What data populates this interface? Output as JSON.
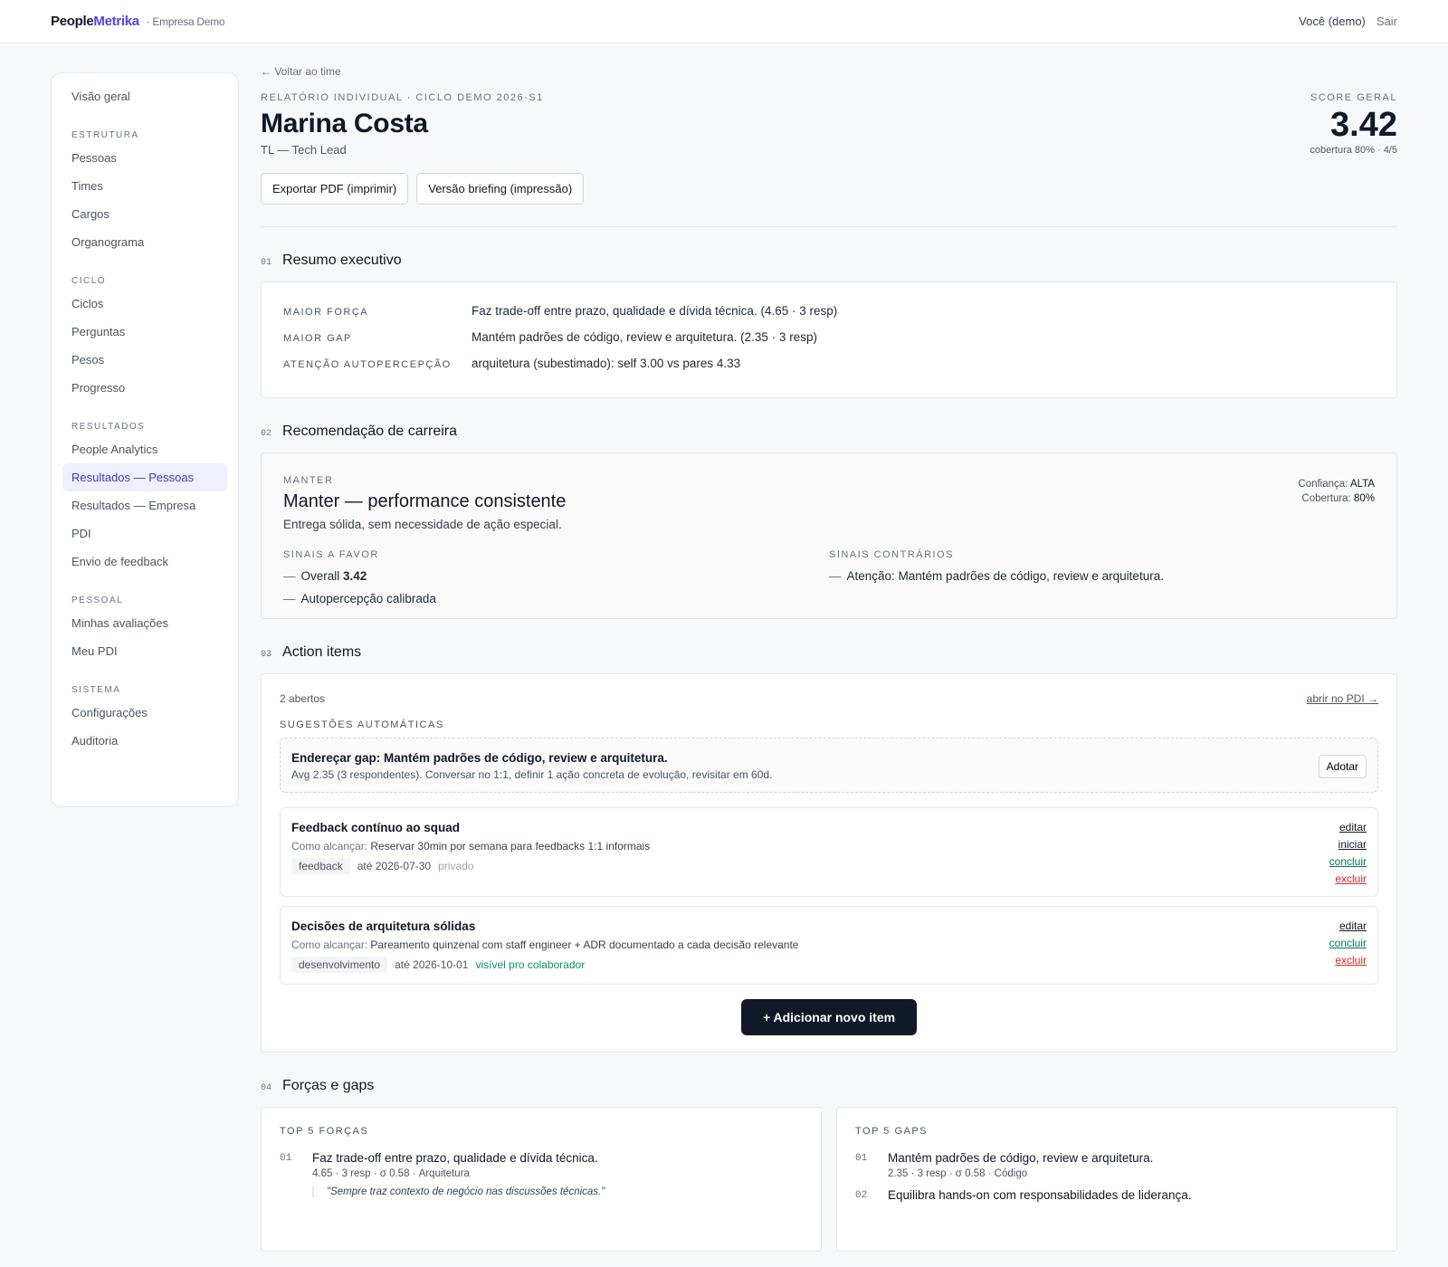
{
  "topbar": {
    "brand_people": "People",
    "brand_metrika": "Metrika",
    "company": "· Empresa Demo",
    "user": "Você (demo)",
    "logout": "Sair"
  },
  "sidebar": {
    "overview": "Visão geral",
    "groups": {
      "estrutura": "ESTRUTURA",
      "ciclo": "CICLO",
      "resultados": "RESULTADOS",
      "pessoal": "PESSOAL",
      "sistema": "SISTEMA"
    },
    "items": {
      "pessoas": "Pessoas",
      "times": "Times",
      "cargos": "Cargos",
      "organograma": "Organograma",
      "ciclos": "Ciclos",
      "perguntas": "Perguntas",
      "pesos": "Pesos",
      "progresso": "Progresso",
      "people_analytics": "People Analytics",
      "resultados_pessoas": "Resultados — Pessoas",
      "resultados_empresa": "Resultados — Empresa",
      "pdi": "PDI",
      "envio_feedback": "Envio de feedback",
      "minhas_avaliacoes": "Minhas avaliações",
      "meu_pdi": "Meu PDI",
      "configuracoes": "Configurações",
      "auditoria": "Auditoria"
    }
  },
  "header": {
    "back": "← Voltar ao time",
    "eyebrow": "RELATÓRIO INDIVIDUAL · CICLO DEMO 2026-S1",
    "name": "Marina Costa",
    "role": "TL — Tech Lead",
    "score_label": "SCORE GERAL",
    "score_value": "3.42",
    "coverage": "cobertura 80% · 4/5",
    "btn_pdf": "Exportar PDF (imprimir)",
    "btn_briefing": "Versão briefing (impressão)"
  },
  "sections": {
    "s1": {
      "num": "01",
      "title": "Resumo executivo"
    },
    "s2": {
      "num": "02",
      "title": "Recomendação de carreira"
    },
    "s3": {
      "num": "03",
      "title": "Action items"
    },
    "s4": {
      "num": "04",
      "title": "Forças e gaps"
    }
  },
  "summary": [
    {
      "label": "MAIOR FORÇA",
      "value": "Faz trade-off entre prazo, qualidade e dívida técnica. (4.65 · 3 resp)"
    },
    {
      "label": "MAIOR GAP",
      "value": "Mantém padrões de código, review e arquitetura. (2.35 · 3 resp)"
    },
    {
      "label": "ATENÇÃO AUTOPERCEPÇÃO",
      "value": "arquitetura (subestimado): self 3.00 vs pares 4.33"
    }
  ],
  "career": {
    "eyebrow": "MANTER",
    "title": "Manter — performance consistente",
    "subtitle": "Entrega sólida, sem necessidade de ação especial.",
    "confidence_label": "Confiança:",
    "confidence_value": "ALTA",
    "coverage_label": "Cobertura:",
    "coverage_value": "80%",
    "pro_label": "SINAIS A FAVOR",
    "pro_1_text": "Overall",
    "pro_1_value": "3.42",
    "pro_2": "Autopercepção calibrada",
    "con_label": "SINAIS CONTRÁRIOS",
    "con_1": "Atenção: Mantém padrões de código, review e arquitetura.",
    "dash": "—"
  },
  "actions": {
    "open_count": "2 abertos",
    "pdi_link": "abrir no PDI →",
    "auto_label": "SUGESTÕES AUTOMÁTICAS",
    "suggestion_title": "Endereçar gap: Mantém padrões de código, review e arquitetura.",
    "suggestion_desc": "Avg 2.35 (3 respondentes). Conversar no 1:1, definir 1 ação concreta de evolução, revisitar em 60d.",
    "adopt": "Adotar",
    "how_label": "Como alcançar:",
    "items": [
      {
        "title": "Feedback contínuo ao squad",
        "how": "Reservar 30min por semana para feedbacks 1:1 informais",
        "tag": "feedback",
        "due": "até 2026-07-30",
        "visibility": "privado"
      },
      {
        "title": "Decisões de arquitetura sólidas",
        "how": "Pareamento quinzenal com staff engineer + ADR documentado a cada decisão relevante",
        "tag": "desenvolvimento",
        "due": "até 2026-10-01",
        "visibility": "visível pro colaborador"
      }
    ],
    "edit": "editar",
    "start": "iniciar",
    "done": "concluir",
    "delete": "excluir",
    "add": "+ Adicionar novo item"
  },
  "forces_gaps": {
    "forces_label": "TOP 5 FORÇAS",
    "gaps_label": "TOP 5 GAPS",
    "forces": [
      {
        "num": "01",
        "title": "Faz trade-off entre prazo, qualidade e dívida técnica.",
        "meta": "4.65 · 3 resp · σ 0.58 · Arquitetura",
        "quote": "\"Sempre traz contexto de negócio nas discussões técnicas.\""
      }
    ],
    "gaps": [
      {
        "num": "01",
        "title": "Mantém padrões de código, review e arquitetura.",
        "meta": "2.35 · 3 resp · σ 0.58 · Código"
      },
      {
        "num": "02",
        "title": "Equilibra hands-on com responsabilidades de liderança."
      }
    ]
  }
}
